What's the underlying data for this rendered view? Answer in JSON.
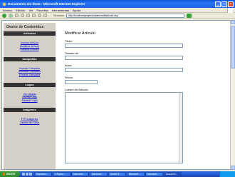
{
  "window": {
    "title": "Documento sin título - Microsoft Internet Explorer"
  },
  "menu": [
    "Archivo",
    "Edición",
    "Ver",
    "Favoritos",
    "Herramientas",
    "Ayuda"
  ],
  "toolbar": {
    "address_label": "Dirección",
    "address_value": "http://localhost/pruyecto/admin/editarticulo.asp"
  },
  "sidebar": {
    "title": "Gestor de Contenidos",
    "sections": [
      {
        "header": "Artículos",
        "links": [
          "Insertar Artículo",
          "Modificar Artículo",
          "Eliminar Artículo"
        ]
      },
      {
        "header": "Campañas",
        "links": [
          "Insertar Campaña",
          "Modificar Campaña",
          "Eliminar Campaña"
        ]
      },
      {
        "header": "Logos",
        "links": [
          "Ver Listado",
          "Insertar Logo",
          "Eliminar Logo"
        ]
      },
      {
        "header": "Imágenes",
        "links": [
          "FTP Imágenes",
          "Cambio de Clave"
        ]
      }
    ]
  },
  "form": {
    "heading": "Modificar Artículo",
    "fields": [
      "Título:",
      "Tomado de:",
      "Autor:",
      "Fecha:"
    ],
    "body_label": "Cuerpo del Artículo:"
  },
  "status": {
    "zone": "Intranet local"
  },
  "taskbar": {
    "start": "Inicio",
    "tasks": [
      "Reproduc...",
      "3 Explor...",
      "Macrome...",
      "Macrome...",
      "Adobe R...",
      "Microsoft...",
      "Microsoft...",
      "Documen..."
    ]
  }
}
